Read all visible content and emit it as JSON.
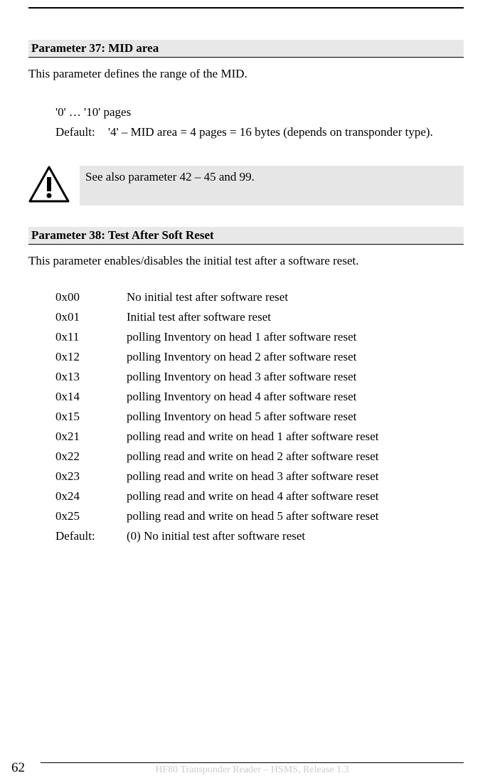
{
  "param37": {
    "header": "Parameter 37: MID area",
    "description": "This parameter defines the range of the MID.",
    "range": "'0' … '10' pages",
    "default_label": "Default:",
    "default_value": "'4' – MID area = 4 pages = 16 bytes (depends on transponder type)."
  },
  "note": {
    "text": "See also parameter 42 – 45 and 99."
  },
  "param38": {
    "header": "Parameter 38: Test After Soft Reset",
    "description": "This parameter enables/disables the initial test after a software reset."
  },
  "values": [
    {
      "code": "0x00",
      "desc": "No initial test after software reset"
    },
    {
      "code": "0x01",
      "desc": "Initial test after software reset"
    },
    {
      "code": "0x11",
      "desc": "polling Inventory on head 1 after software reset"
    },
    {
      "code": "0x12",
      "desc": "polling Inventory on head 2 after software reset"
    },
    {
      "code": "0x13",
      "desc": "polling Inventory on head 3 after software reset"
    },
    {
      "code": "0x14",
      "desc": "polling Inventory on head 4 after software reset"
    },
    {
      "code": "0x15",
      "desc": "polling Inventory on head 5 after software reset"
    },
    {
      "code": "0x21",
      "desc": "polling read and write on head 1 after software reset"
    },
    {
      "code": "0x22",
      "desc": "polling read and write on head 2 after software reset"
    },
    {
      "code": "0x23",
      "desc": "polling read and write on head 3 after software reset"
    },
    {
      "code": "0x24",
      "desc": "polling read and write on head 4 after software reset"
    },
    {
      "code": "0x25",
      "desc": "polling read and write on head 5 after software reset"
    },
    {
      "code": "Default:",
      "desc": "(0) No initial test after software reset"
    }
  ],
  "footer": {
    "page_number": "62",
    "text": "HF80 Transponder Reader – HSMS, Release 1.3"
  }
}
